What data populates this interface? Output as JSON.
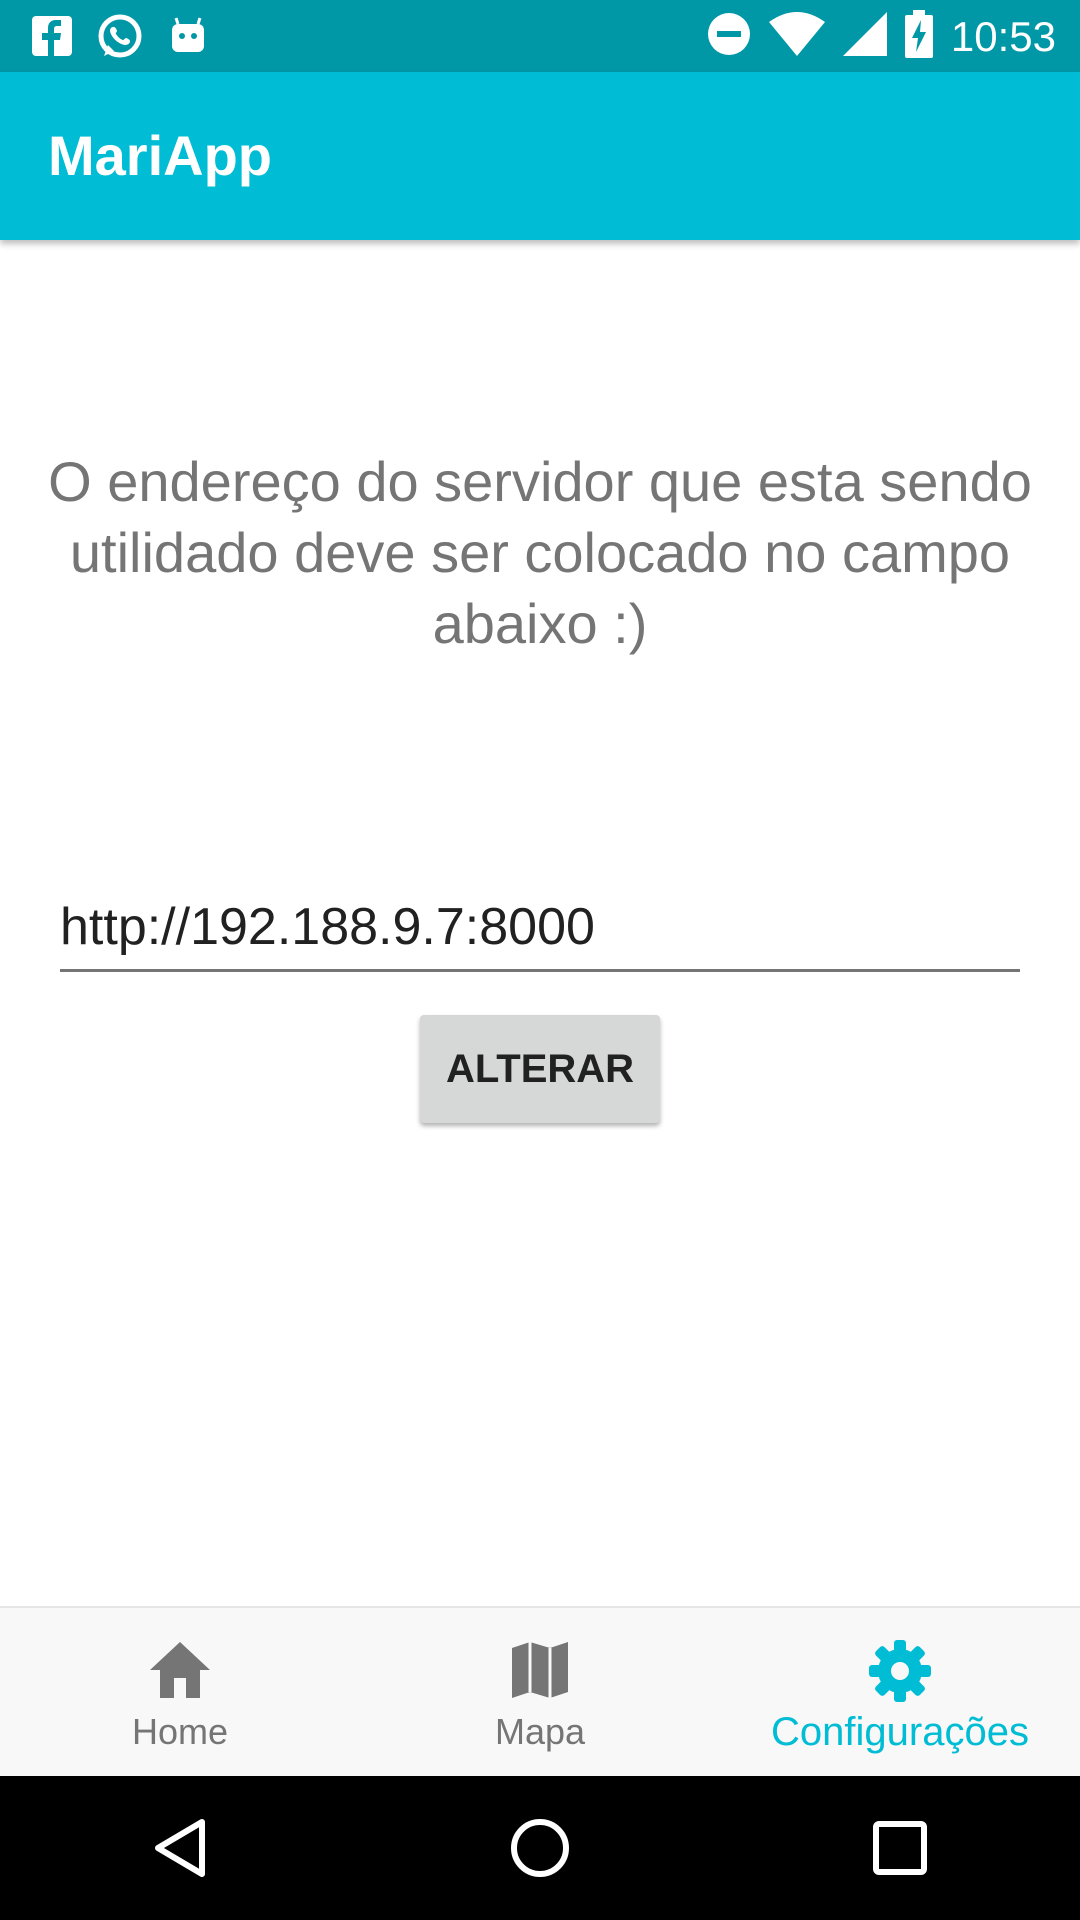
{
  "status_bar": {
    "time": "10:53",
    "icons": [
      "facebook-icon",
      "whatsapp-icon",
      "android-icon",
      "dnd-icon",
      "wifi-icon",
      "signal-icon",
      "battery-charging-icon"
    ]
  },
  "app_bar": {
    "title": "MariApp"
  },
  "main": {
    "message": "O endereço do servidor que esta sendo utilidado deve ser colocado no campo abaixo :)",
    "server_field": {
      "value": "http://192.188.9.7:8000"
    },
    "change_button": {
      "label": "ALTERAR"
    }
  },
  "bottom_nav": {
    "items": [
      {
        "label": "Home",
        "icon": "home-icon",
        "active": false
      },
      {
        "label": "Mapa",
        "icon": "map-icon",
        "active": false
      },
      {
        "label": "Configurações",
        "icon": "gear-icon",
        "active": true
      }
    ]
  },
  "colors": {
    "status_bar": "#0097A7",
    "app_bar": "#00BCD4",
    "accent": "#00BCD4",
    "inactive": "#757575"
  }
}
